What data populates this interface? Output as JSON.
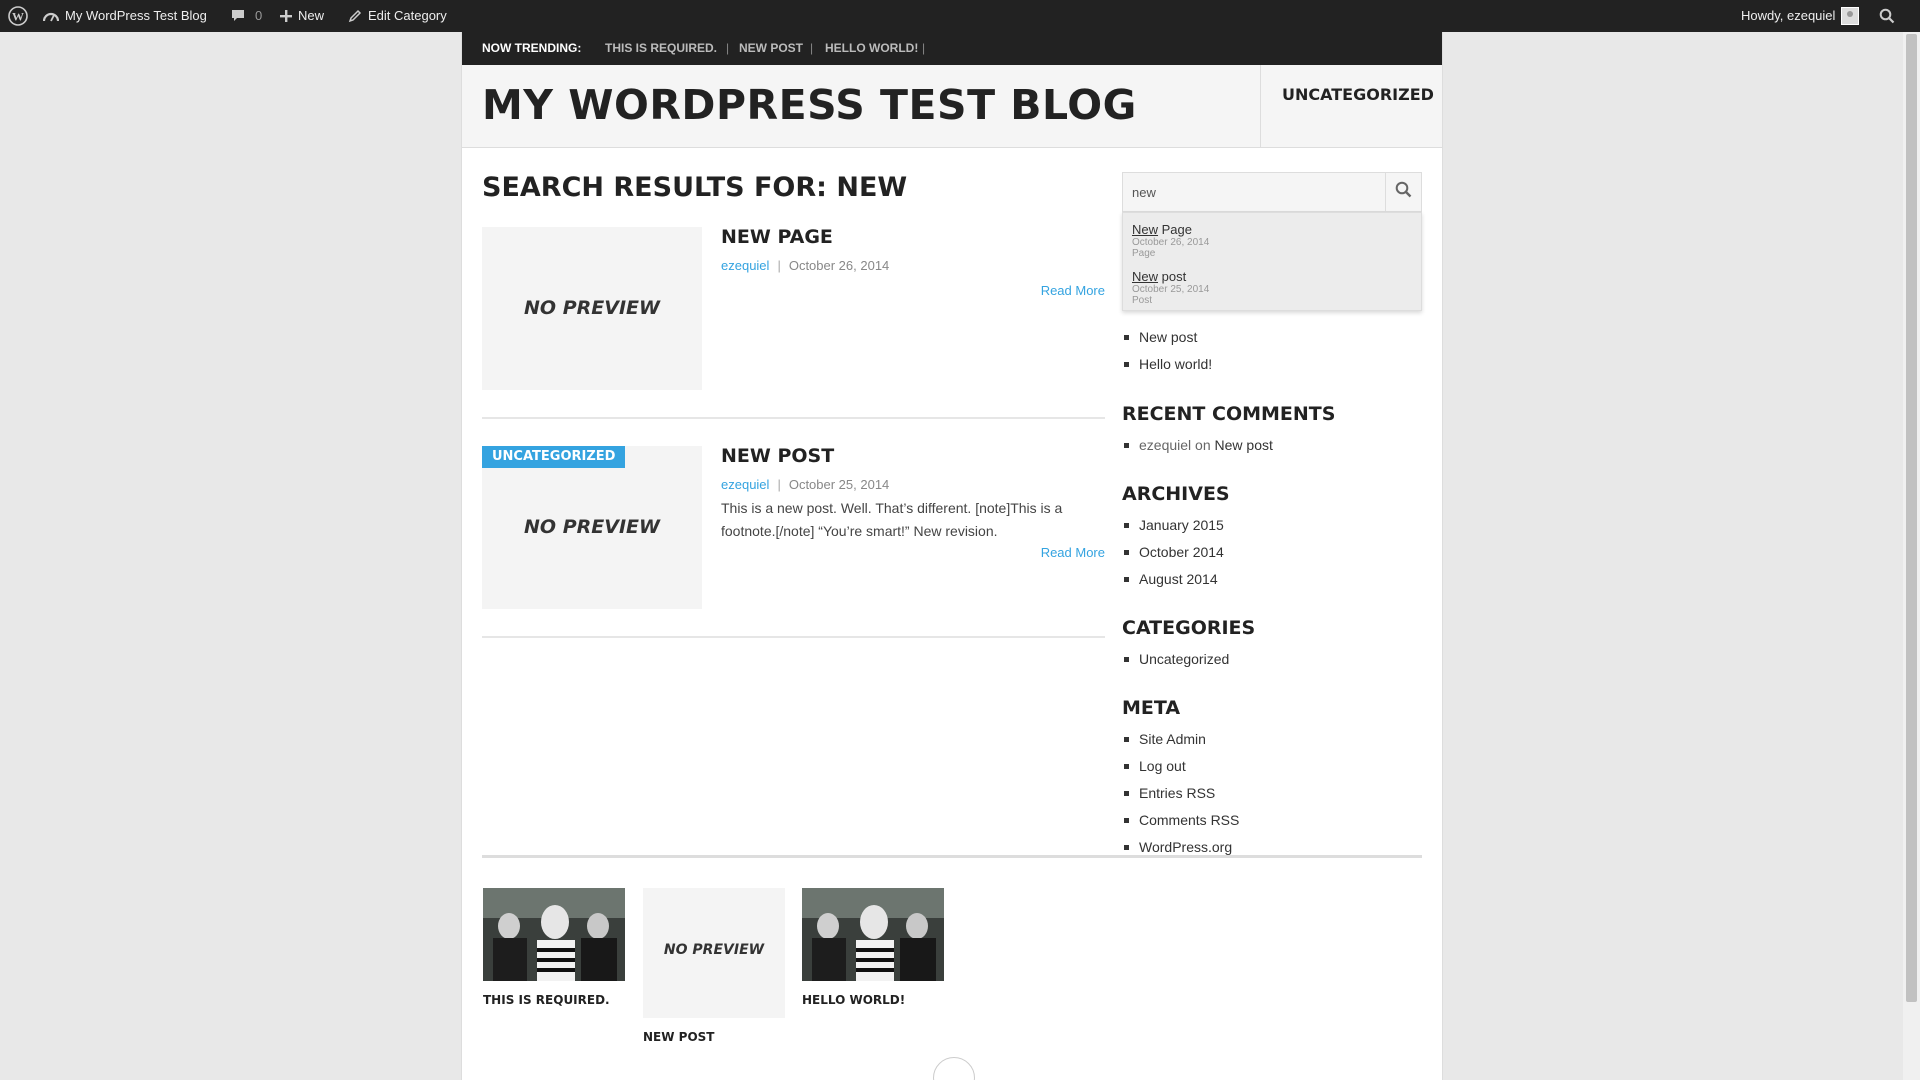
{
  "admin_bar": {
    "site_name": "My WordPress Test Blog",
    "comments_count": "0",
    "new_label": "New",
    "edit_label": "Edit Category",
    "howdy": "Howdy, ezequiel"
  },
  "trending": {
    "label": "NOW TRENDING:",
    "items": [
      "THIS IS REQUIRED.",
      "NEW POST",
      "HELLO WORLD!"
    ],
    "separator": "|"
  },
  "header": {
    "site_title": "MY WORDPRESS TEST BLOG",
    "nav_item": "UNCATEGORIZED"
  },
  "search_heading": "SEARCH RESULTS FOR: NEW",
  "posts": [
    {
      "title": "NEW PAGE",
      "author": "ezequiel",
      "date": "October 26, 2014",
      "excerpt": "",
      "read_more": "Read More",
      "preview": "NO PREVIEW",
      "category": ""
    },
    {
      "title": "NEW POST",
      "author": "ezequiel",
      "date": "October 25, 2014",
      "excerpt": "This is a new post. Well. That’s different. [note]This is a footnote.[/note] “You’re smart!” New revision.",
      "read_more": "Read More",
      "preview": "NO PREVIEW",
      "category": "UNCATEGORIZED"
    }
  ],
  "sidebar": {
    "search_value": "new",
    "autocomplete": [
      {
        "match": "New",
        "rest": " Page",
        "date": "October 26, 2014",
        "type": "Page"
      },
      {
        "match": "New",
        "rest": " post",
        "date": "October 25, 2014",
        "type": "Post"
      }
    ],
    "recent_posts": [
      "New post",
      "Hello world!"
    ],
    "recent_comments_title": "RECENT COMMENTS",
    "recent_comment": {
      "author": "ezequiel",
      "on": "on",
      "post": "New post"
    },
    "archives_title": "ARCHIVES",
    "archives": [
      "January 2015",
      "October 2014",
      "August 2014"
    ],
    "categories_title": "CATEGORIES",
    "categories": [
      "Uncategorized"
    ],
    "meta_title": "META",
    "meta": [
      "Site Admin",
      "Log out",
      "Entries RSS",
      "Comments RSS",
      "WordPress.org"
    ]
  },
  "footer_posts": [
    {
      "title": "THIS IS REQUIRED.",
      "type": "image"
    },
    {
      "title": "NEW POST",
      "type": "no-preview",
      "preview": "NO PREVIEW"
    },
    {
      "title": "HELLO WORLD!",
      "type": "image"
    }
  ],
  "colors": {
    "accent": "#34a3e0",
    "admin_bar": "#222222",
    "page_bg": "#e8e8e8"
  }
}
